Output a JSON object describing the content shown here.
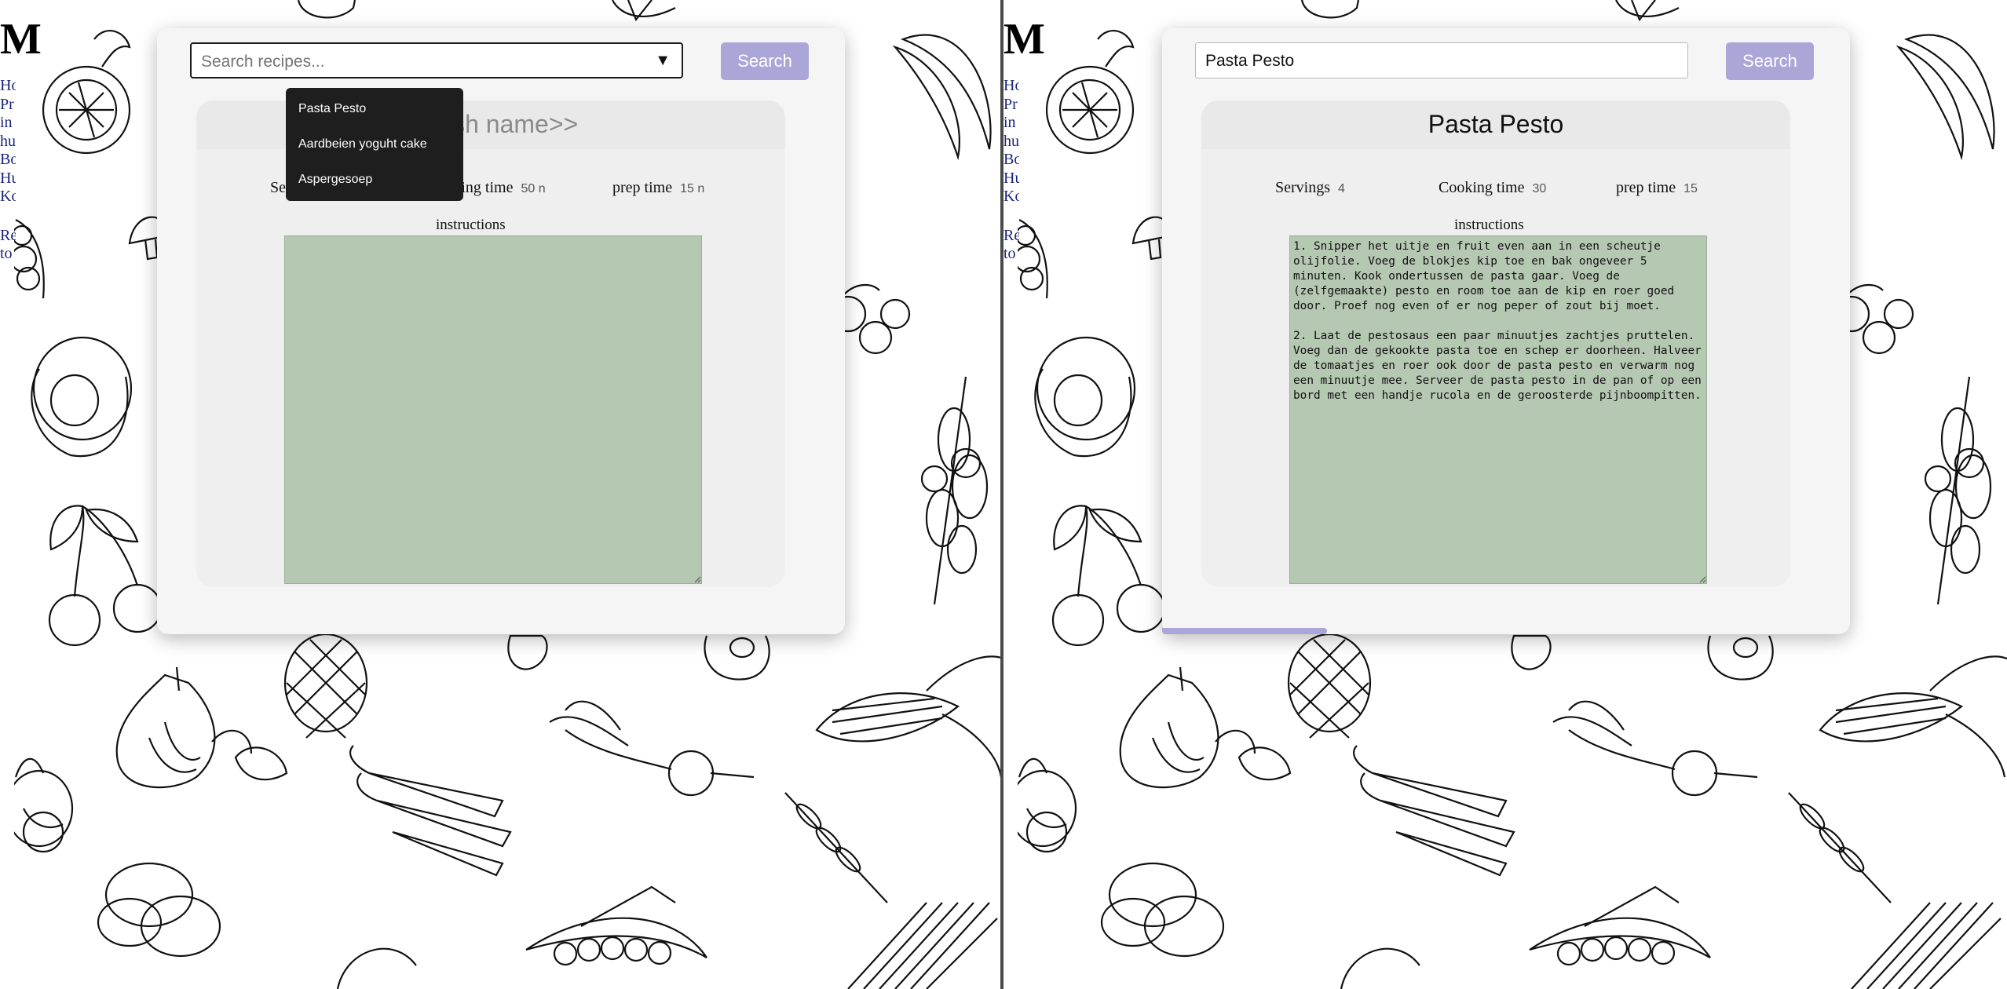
{
  "colors": {
    "accent": "#aba6d8",
    "card": "#f5f5f5",
    "textarea": "#b5c8b1",
    "dropdown": "#1e1e1e"
  },
  "page": {
    "heading_letter": "M",
    "nav_links": [
      "Ho",
      "Pr",
      "in",
      "hu",
      "Bo",
      "Hu",
      "Ko"
    ],
    "nav_links_2": [
      "Re",
      "to"
    ]
  },
  "left": {
    "search": {
      "placeholder": "Search recipes...",
      "dropdown_icon": "triangle-down-icon",
      "button": "Search",
      "options": [
        "Pasta Pesto",
        "Aardbeien yoguht cake",
        "Aspergesoep"
      ]
    },
    "recipe": {
      "title": "<<dish name>>",
      "servings_label": "Servings",
      "servings_value": "",
      "cooking_label": "Cooking time",
      "cooking_value": "50 n",
      "prep_label": "prep time",
      "prep_value": "15 n",
      "instructions_label": "instructions",
      "instructions": ""
    }
  },
  "right": {
    "search": {
      "value": "Pasta Pesto",
      "button": "Search"
    },
    "recipe": {
      "title": "Pasta Pesto",
      "servings_label": "Servings",
      "servings_value": "4",
      "cooking_label": "Cooking time",
      "cooking_value": "30",
      "prep_label": "prep time",
      "prep_value": "15",
      "instructions_label": "instructions",
      "instructions": "1. Snipper het uitje en fruit even aan in een scheutje olijfolie. Voeg de blokjes kip toe en bak ongeveer 5 minuten. Kook ondertussen de pasta gaar. Voeg de (zelfgemaakte) pesto en room toe aan de kip en roer goed door. Proef nog even of er nog peper of zout bij moet.\n\n2. Laat de pestosaus een paar minuutjes zachtjes pruttelen. Voeg dan de gekookte pasta toe en schep er doorheen. Halveer de tomaatjes en roer ook door de pasta pesto en verwarm nog een minuutje mee. Serveer de pasta pesto in de pan of op een bord met een handje rucola en de geroosterde pijnboompitten."
    },
    "progress": 0.24
  }
}
